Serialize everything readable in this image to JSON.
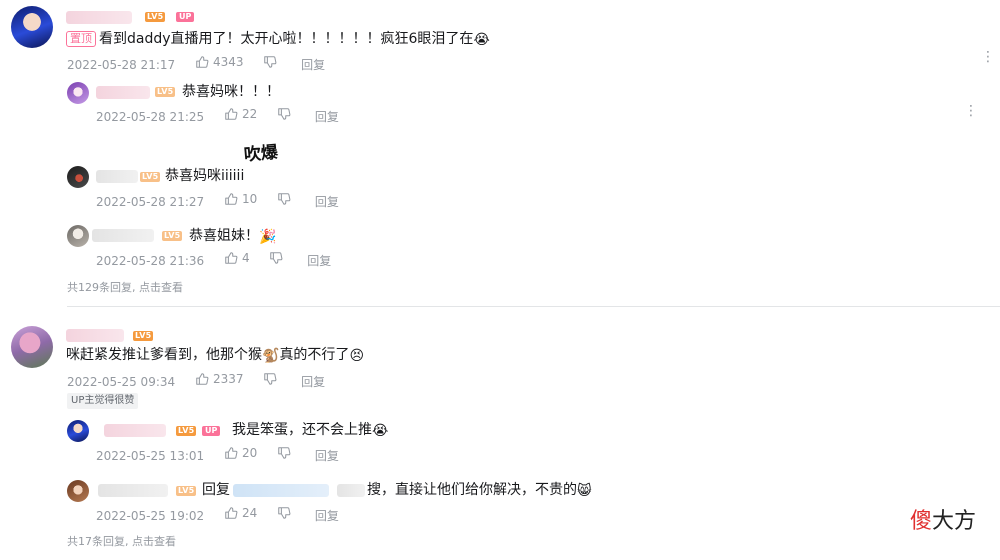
{
  "colors": {
    "accent": "#fb7299",
    "level": "#f59a3e",
    "meta": "#9499a0"
  },
  "comments": [
    {
      "level": "LV5",
      "up_badge": "UP",
      "pinned_label": "置顶",
      "content": "看到daddy直播用了！太开心啦！！！！！！疯狂6眼泪了在",
      "content_emoji": "😭",
      "time": "2022-05-28 21:17",
      "likes": "4343",
      "reply_label": "回复",
      "replies": [
        {
          "level": "LV5",
          "content": "恭喜妈咪！！！",
          "time": "2022-05-28 21:25",
          "likes": "22",
          "reply_label": "回复"
        },
        {
          "level": "LV5",
          "content": "恭喜妈咪iiiiii",
          "sticker_text": "吹爆",
          "time": "2022-05-28 21:27",
          "likes": "10",
          "reply_label": "回复"
        },
        {
          "level": "LV5",
          "content": "恭喜姐妹！",
          "content_emoji": "🎉",
          "time": "2022-05-28 21:36",
          "likes": "4",
          "reply_label": "回复"
        }
      ],
      "more_replies": "共129条回复, 点击查看"
    },
    {
      "level": "LV5",
      "content": "咪赶紧发推让爹看到，他那个猴",
      "content_emoji_mid": "🐒",
      "content_after": "真的不行了",
      "content_emoji": "😣",
      "time": "2022-05-25 09:34",
      "likes": "2337",
      "reply_label": "回复",
      "up_note": "UP主觉得很赞",
      "replies": [
        {
          "level": "LV5",
          "up_badge": "UP",
          "content": "我是笨蛋，还不会上推",
          "content_emoji": "😭",
          "time": "2022-05-25 13:01",
          "likes": "20",
          "reply_label": "回复"
        },
        {
          "level": "LV5",
          "reply_prefix": "回复",
          "content": "搜，直接让他们给你解决，不贵的",
          "content_emoji": "😸",
          "time": "2022-05-25 19:02",
          "likes": "24",
          "reply_label": "回复"
        }
      ],
      "more_replies": "共17条回复, 点击查看"
    }
  ],
  "watermark": {
    "part1": "傻",
    "part2": "大方"
  },
  "icons": {
    "like": "thumbs-up-icon",
    "dislike": "thumbs-down-icon",
    "more": "more-vertical-icon"
  }
}
